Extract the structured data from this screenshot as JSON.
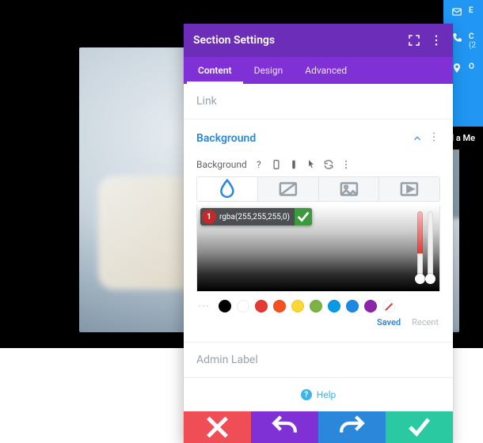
{
  "panel": {
    "title": "Section Settings",
    "tabs": [
      {
        "label": "Content",
        "active": true
      },
      {
        "label": "Design",
        "active": false
      },
      {
        "label": "Advanced",
        "active": false
      }
    ],
    "groups": {
      "link": {
        "label": "Link",
        "open": false
      },
      "background": {
        "label": "Background",
        "open": true,
        "field_label": "Background",
        "color_value": "rgba(255,255,255,0)",
        "badge": "1",
        "swatches": [
          "#000000",
          "#ffffff",
          "#e53935",
          "#f4511e",
          "#fdd835",
          "#7cb342",
          "#039be5",
          "#1e88e5",
          "#8e24aa"
        ],
        "saved_label": "Saved",
        "recent_label": "Recent"
      },
      "admin": {
        "label": "Admin Label",
        "open": false
      }
    },
    "help_label": "Help"
  },
  "contact": {
    "items": [
      {
        "icon": "mail-icon",
        "label": "E"
      },
      {
        "icon": "phone-icon",
        "label": "C",
        "sub": "(2"
      },
      {
        "icon": "pin-icon",
        "label": "O"
      }
    ],
    "send_label": "Send a Me"
  }
}
